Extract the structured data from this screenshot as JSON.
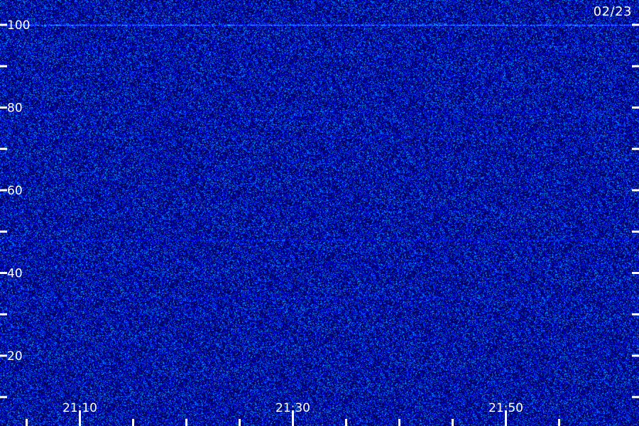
{
  "date_label": "02/23",
  "chart_data": {
    "type": "heatmap",
    "title": "",
    "xlabel": "",
    "ylabel": "",
    "colormap": [
      "#000000",
      "#0000ff",
      "#00ffff",
      "#00ff00"
    ],
    "background_color": "#0a0a55",
    "x_tick_labels": [
      {
        "label": "21:10",
        "minutes": 10
      },
      {
        "label": "21:30",
        "minutes": 30
      },
      {
        "label": "21:50",
        "minutes": 50
      }
    ],
    "x_minor_ticks_minutes": [
      5,
      10,
      15,
      20,
      25,
      30,
      35,
      40,
      45,
      50,
      55
    ],
    "xlim_minutes": [
      2.5,
      62.5
    ],
    "y_ticks": [
      10,
      20,
      30,
      40,
      50,
      60,
      70,
      80,
      90,
      100
    ],
    "y_tick_labels": [
      {
        "label": "20",
        "value": 20
      },
      {
        "label": "40",
        "value": 40
      },
      {
        "label": "60",
        "value": 60
      },
      {
        "label": "80",
        "value": 80
      },
      {
        "label": "100",
        "value": 100
      }
    ],
    "ylim": [
      3,
      106
    ],
    "bands": [
      {
        "value": 100,
        "intensity": 0.95
      },
      {
        "value": 95,
        "intensity": 0.35
      },
      {
        "value": 93,
        "intensity": 0.3
      },
      {
        "value": 88,
        "intensity": 0.3
      },
      {
        "value": 85,
        "intensity": 0.3
      },
      {
        "value": 79,
        "intensity": 0.45
      },
      {
        "value": 77,
        "intensity": 0.35
      },
      {
        "value": 73,
        "intensity": 0.4
      },
      {
        "value": 67,
        "intensity": 0.3
      },
      {
        "value": 63,
        "intensity": 0.3
      },
      {
        "value": 55,
        "intensity": 0.35
      },
      {
        "value": 48,
        "intensity": 0.5
      },
      {
        "value": 42,
        "intensity": 0.35
      },
      {
        "value": 34,
        "intensity": 0.45
      },
      {
        "value": 31,
        "intensity": 0.3
      },
      {
        "value": 23,
        "intensity": 0.25
      }
    ]
  }
}
